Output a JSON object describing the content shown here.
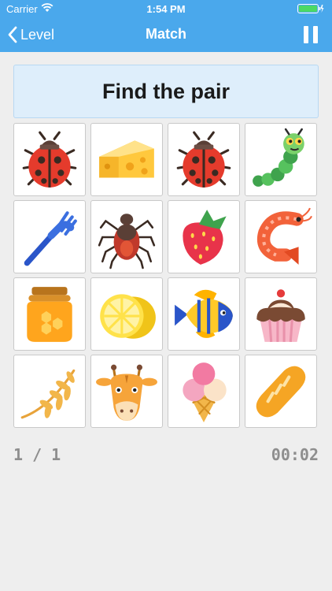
{
  "status_bar": {
    "carrier": "Carrier",
    "time": "1:54 PM"
  },
  "nav": {
    "back_label": "Level",
    "title": "Match"
  },
  "prompt": {
    "text": "Find the pair"
  },
  "cards": [
    {
      "icon": "ladybug-icon"
    },
    {
      "icon": "cheese-icon"
    },
    {
      "icon": "ladybug-icon"
    },
    {
      "icon": "caterpillar-icon"
    },
    {
      "icon": "fork-icon"
    },
    {
      "icon": "tick-icon"
    },
    {
      "icon": "strawberry-icon"
    },
    {
      "icon": "shrimp-icon"
    },
    {
      "icon": "honey-jar-icon"
    },
    {
      "icon": "lemon-icon"
    },
    {
      "icon": "tropical-fish-icon"
    },
    {
      "icon": "cupcake-icon"
    },
    {
      "icon": "wheat-icon"
    },
    {
      "icon": "giraffe-icon"
    },
    {
      "icon": "ice-cream-icon"
    },
    {
      "icon": "bread-icon"
    }
  ],
  "footer": {
    "progress": "1 / 1",
    "timer": "00:02"
  },
  "colors": {
    "accent": "#4aa8ec",
    "prompt_bg": "#deeefb"
  }
}
